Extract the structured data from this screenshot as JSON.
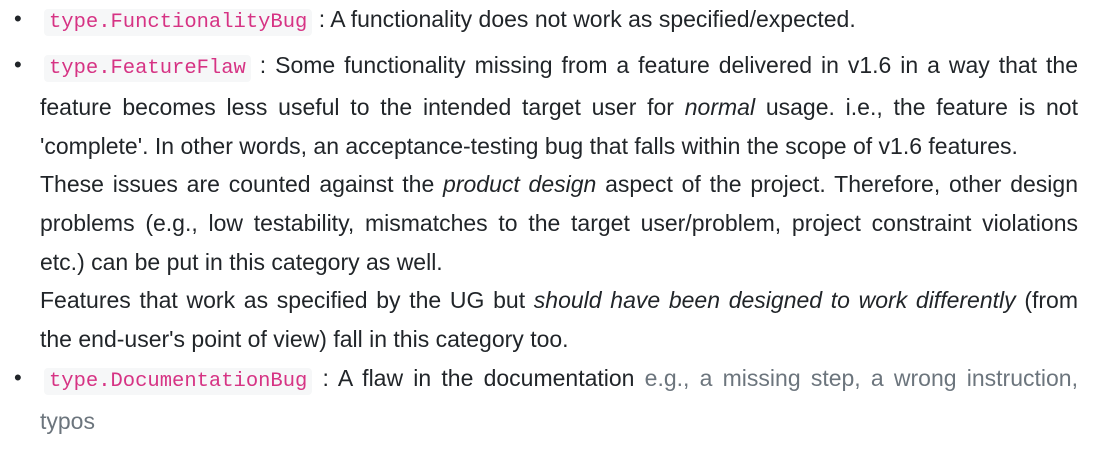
{
  "items": [
    {
      "tag": "type.FunctionalityBug",
      "sep": " : ",
      "text": "A functionality does not work as specified/expected."
    },
    {
      "tag": "type.FeatureFlaw",
      "sep": " : ",
      "p1": {
        "a": "Some functionality missing from a feature delivered in v1.6 in a way that the feature becomes less useful to the intended target user for ",
        "em": "normal",
        "b": " usage. i.e., the feature is not 'complete'. In other words, an acceptance-testing bug that falls within the scope of v1.6 features."
      },
      "p2": {
        "a": "These issues are counted against the ",
        "em": "product design",
        "b": " aspect of the project. Therefore, other design problems (e.g., low testability, mismatches to the target user/problem, project constraint violations etc.) can be put in this category as well."
      },
      "p3": {
        "a": "Features that work as specified by the UG but ",
        "em": "should have been designed to work differently",
        "b": " (from the end-user's point of view) fall in this category too."
      }
    },
    {
      "tag": "type.DocumentationBug",
      "sep": " : ",
      "text": "A flaw in the documentation",
      "muted": " e.g., a missing step, a wrong instruction, typos"
    }
  ],
  "colors": {
    "code": "#d63384",
    "code_bg": "#f6f7f8",
    "text": "#212529",
    "muted": "#6c757d"
  }
}
